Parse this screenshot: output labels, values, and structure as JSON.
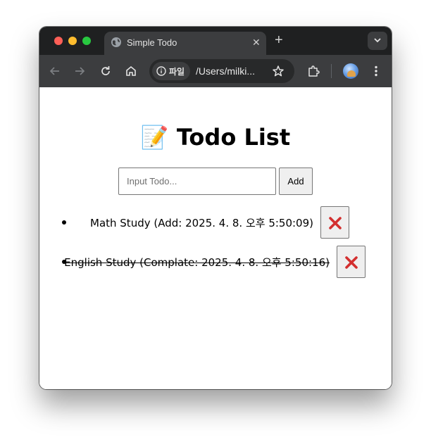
{
  "browser": {
    "tab": {
      "title": "Simple Todo",
      "close_glyph": "✕",
      "favicon": "globe-icon"
    },
    "new_tab_glyph": "+",
    "site_chip_label": "파일",
    "url": "/Users/milki...",
    "accent_color": "#3c3d3f"
  },
  "page": {
    "title": "📝 Todo List",
    "input": {
      "placeholder": "Input Todo...",
      "value": ""
    },
    "add_button_label": "Add",
    "todos": [
      {
        "text": "Math Study (Add: 2025. 4. 8. 오후 5:50:09)",
        "completed": false
      },
      {
        "text": "English Study (Complate: 2025. 4. 8. 오후 5:50:16)",
        "completed": true
      }
    ],
    "delete_color": "#d32f2f"
  }
}
